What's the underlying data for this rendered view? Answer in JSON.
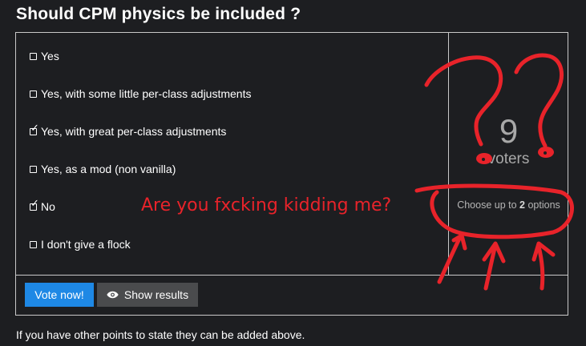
{
  "poll": {
    "title": "Should CPM physics be included ?",
    "options": [
      {
        "label": "Yes",
        "checked": false
      },
      {
        "label": "Yes, with some little per-class adjustments",
        "checked": false
      },
      {
        "label": "Yes, with great per-class adjustments",
        "checked": true
      },
      {
        "label": "Yes, as a mod (non vanilla)",
        "checked": false
      },
      {
        "label": "No",
        "checked": true
      },
      {
        "label": "I don't give a flock",
        "checked": false
      }
    ],
    "voter_count": "9",
    "voters_label": "voters",
    "choose_prefix": "Choose up to ",
    "choose_max": "2",
    "choose_suffix": " options"
  },
  "buttons": {
    "vote_label": "Vote now!",
    "show_results_label": "Show results"
  },
  "note": "If you have other points to state they can be added above.",
  "annotation": {
    "caption": "Are you fxcking kidding me?",
    "color": "#e8232a"
  },
  "colors": {
    "background": "#1d1e21",
    "vote_button": "#1e88e5",
    "results_button": "#4a4b4d",
    "border": "#c9c9c9"
  }
}
